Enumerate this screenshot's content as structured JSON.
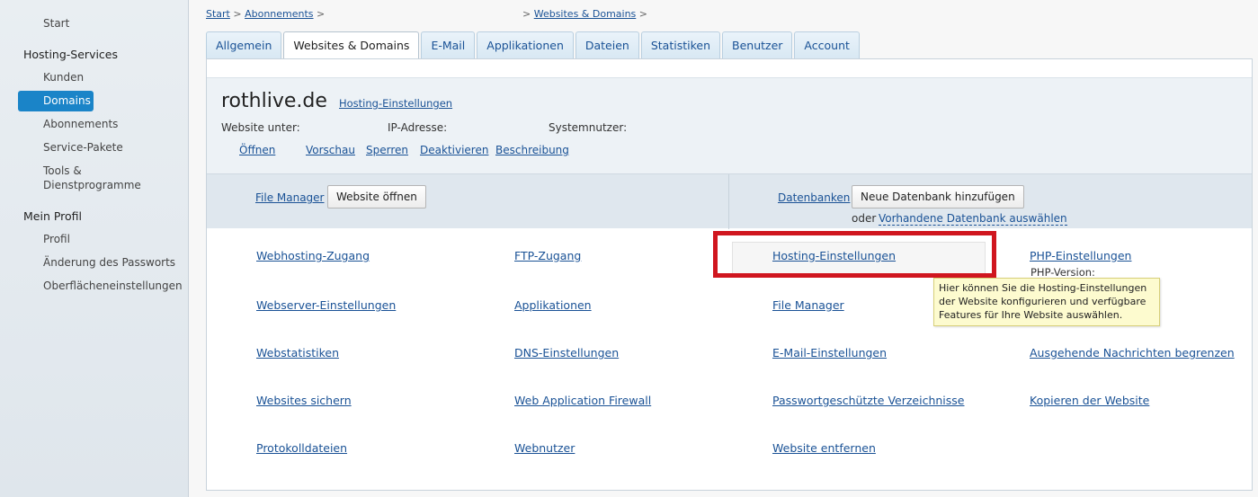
{
  "sidebar": {
    "start": "Start",
    "hosting_heading": "Hosting-Services",
    "kunden": "Kunden",
    "domains": "Domains",
    "abonnements": "Abonnements",
    "service_pakete": "Service-Pakete",
    "tools_line1": "Tools &",
    "tools_line2": "Dienstprogramme",
    "profile_heading": "Mein Profil",
    "profil": "Profil",
    "passwort": "Änderung des Passworts",
    "oberflaeche": "Oberflächeneinstellungen"
  },
  "breadcrumb": {
    "start": "Start",
    "abonnements": "Abonnements",
    "websites_domains": "Websites & Domains",
    "sep": ">"
  },
  "tabs": [
    "Allgemein",
    "Websites & Domains",
    "E-Mail",
    "Applikationen",
    "Dateien",
    "Statistiken",
    "Benutzer",
    "Account"
  ],
  "domain": {
    "name": "rothlive.de",
    "hosting_link": "Hosting-Einstellungen",
    "website_unter": "Website unter:",
    "ip_adresse": "IP-Adresse:",
    "systemnutzer": "Systemnutzer:",
    "actions": {
      "oeffnen": "Öffnen",
      "vorschau": "Vorschau",
      "sperren": "Sperren",
      "deaktivieren": "Deaktivieren",
      "beschreibung": "Beschreibung"
    }
  },
  "tools_bar": {
    "file_manager": "File Manager",
    "website_oeffnen": "Website öffnen",
    "datenbanken": "Datenbanken",
    "neue_datenbank": "Neue Datenbank hinzufügen",
    "oder": "oder",
    "vorhandene": "Vorhandene Datenbank auswählen"
  },
  "grid": {
    "webhosting": "Webhosting-Zugang",
    "ftp": "FTP-Zugang",
    "hosting_einstellungen": "Hosting-Einstellungen",
    "php": "PHP-Einstellungen",
    "php_version": "PHP-Version:",
    "webserver": "Webserver-Einstellungen",
    "applikationen": "Applikationen",
    "file_manager": "File Manager",
    "webstatistiken": "Webstatistiken",
    "dns": "DNS-Einstellungen",
    "email": "E-Mail-Einstellungen",
    "ausgehende": "Ausgehende Nachrichten begrenzen",
    "sichern": "Websites sichern",
    "waf": "Web Application Firewall",
    "passwort_verz": "Passwortgeschützte Verzeichnisse",
    "kopieren": "Kopieren der Website",
    "protokoll": "Protokolldateien",
    "webnutzer": "Webnutzer",
    "entfernen": "Website entfernen"
  },
  "tooltip": {
    "line1": "Hier können Sie die Hosting-Einstellungen",
    "line2": "der Website konfigurieren und verfügbare",
    "line3": "Features für Ihre Website auswählen."
  }
}
